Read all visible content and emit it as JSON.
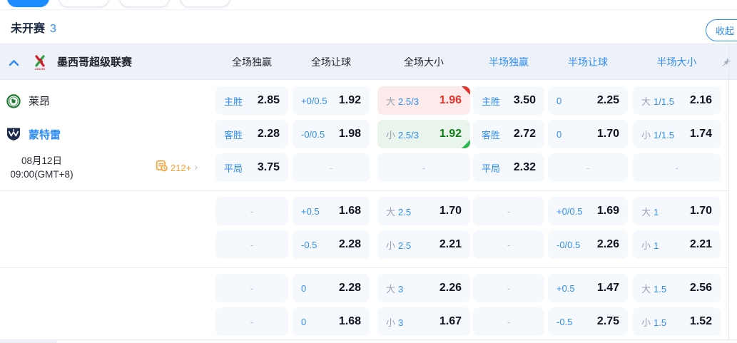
{
  "filter_pills": {
    "count": 4,
    "active_index": 0
  },
  "section": {
    "status_label": "未开赛",
    "match_count": "3",
    "collapse_label": "收起"
  },
  "league": {
    "name": "墨西哥超级联赛"
  },
  "columns": [
    "全场独赢",
    "全场让球",
    "全场大小",
    "半场独赢",
    "半场让球",
    "半场大小"
  ],
  "match": {
    "home_team": "莱昂",
    "away_team": "蒙特雷",
    "date": "08月12日",
    "time": "09:00(GMT+8)",
    "more_markets_count": "212+"
  },
  "colors": {
    "accent_blue": "#2f8df5",
    "value_dark": "#10151d",
    "up_red": "#e5332d",
    "down_green": "#0e7d15",
    "orange": "#ff9e2c",
    "gray_label": "#99a2b3"
  },
  "odds_groups": [
    {
      "rows": [
        {
          "left": "home",
          "cells": [
            {
              "label": "主胜",
              "value": "2.85"
            },
            {
              "label": "+0/0.5",
              "value": "1.92"
            },
            {
              "side": "大",
              "line": "2.5/3",
              "value": "1.96",
              "trend": "up"
            },
            {
              "label": "主胜",
              "value": "3.50"
            },
            {
              "label": "0",
              "value": "2.25"
            },
            {
              "side": "大",
              "line": "1/1.5",
              "value": "2.16"
            }
          ]
        },
        {
          "left": "away",
          "cells": [
            {
              "label": "客胜",
              "value": "2.28"
            },
            {
              "label": "-0/0.5",
              "value": "1.98"
            },
            {
              "side": "小",
              "line": "2.5/3",
              "value": "1.92",
              "trend": "down"
            },
            {
              "label": "客胜",
              "value": "2.72"
            },
            {
              "label": "0",
              "value": "1.70"
            },
            {
              "side": "小",
              "line": "1/1.5",
              "value": "1.74"
            }
          ]
        },
        {
          "left": "schedule",
          "cells": [
            {
              "label": "平局",
              "value": "3.75"
            },
            {
              "dash": true
            },
            {
              "dash": true
            },
            {
              "label": "平局",
              "value": "2.32"
            },
            {
              "dash": true
            },
            {
              "dash": true
            }
          ]
        }
      ]
    },
    {
      "rows": [
        {
          "cells": [
            {
              "dash": true
            },
            {
              "label": "+0.5",
              "value": "1.68"
            },
            {
              "side": "大",
              "line": "2.5",
              "value": "1.70"
            },
            {
              "dash": true
            },
            {
              "label": "+0/0.5",
              "value": "1.69"
            },
            {
              "side": "大",
              "line": "1",
              "value": "1.70"
            }
          ]
        },
        {
          "cells": [
            {
              "dash": true
            },
            {
              "label": "-0.5",
              "value": "2.28"
            },
            {
              "side": "小",
              "line": "2.5",
              "value": "2.21"
            },
            {
              "dash": true
            },
            {
              "label": "-0/0.5",
              "value": "2.26"
            },
            {
              "side": "小",
              "line": "1",
              "value": "2.21"
            }
          ]
        }
      ]
    },
    {
      "rows": [
        {
          "cells": [
            {
              "dash": true
            },
            {
              "label": "0",
              "value": "2.28"
            },
            {
              "side": "大",
              "line": "3",
              "value": "2.26"
            },
            {
              "dash": true
            },
            {
              "label": "+0.5",
              "value": "1.47"
            },
            {
              "side": "大",
              "line": "1.5",
              "value": "2.56"
            }
          ]
        },
        {
          "cells": [
            {
              "dash": true
            },
            {
              "label": "0",
              "value": "1.68"
            },
            {
              "side": "小",
              "line": "3",
              "value": "1.67"
            },
            {
              "dash": true
            },
            {
              "label": "-0.5",
              "value": "2.75"
            },
            {
              "side": "小",
              "line": "1.5",
              "value": "1.52"
            }
          ]
        }
      ]
    }
  ]
}
